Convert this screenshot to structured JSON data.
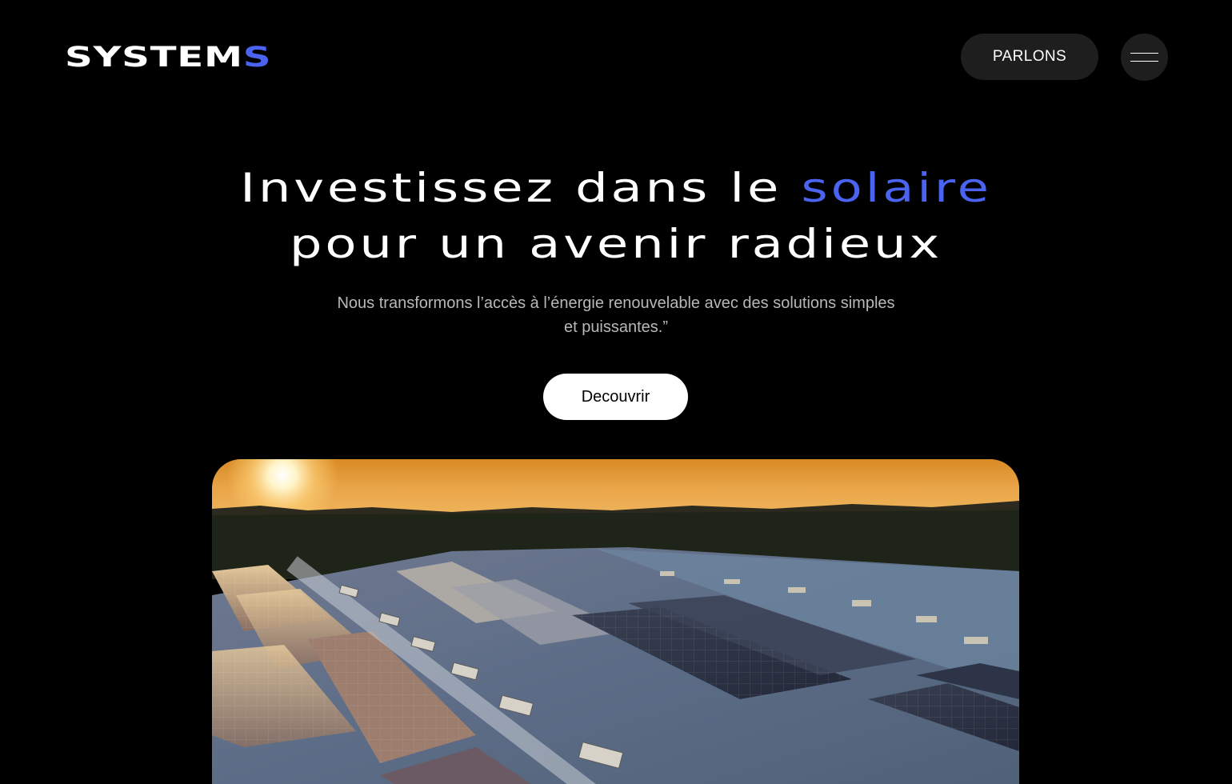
{
  "header": {
    "logo_main": "SYSTEM",
    "logo_accent": "S",
    "cta_label": "PARLONS",
    "menu_icon": "hamburger-icon"
  },
  "hero": {
    "title_line1_prefix": "Investissez dans le",
    "title_line1_accent": "solaire",
    "title_line2": "pour un avenir radieux",
    "subtitle": "Nous transformons l’accès à l’énergie renouvelable avec des solutions simples et puissantes.”",
    "button_label": "Decouvrir"
  },
  "image": {
    "subject": "solar-panels-on-rooftop-at-sunset"
  },
  "colors": {
    "background": "#000000",
    "accent": "#4a63f0",
    "button_dark": "#1e1e1e",
    "button_light": "#ffffff",
    "subtitle_text": "#b8b8b8"
  }
}
